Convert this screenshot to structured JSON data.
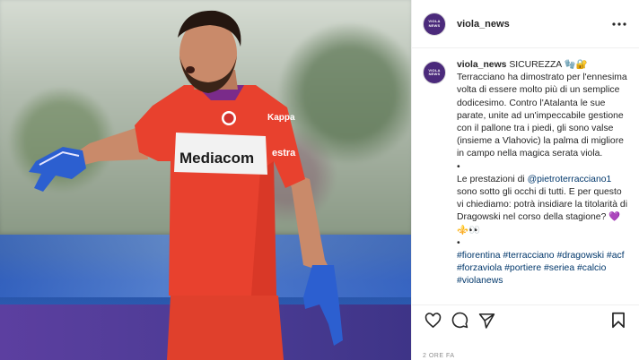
{
  "post": {
    "username": "viola_news",
    "avatar_text": [
      "VIOLA",
      "NEWS",
      "·"
    ],
    "caption": {
      "title": "SICUREZZA 🧤🔐",
      "p1": "Terracciano ha dimostrato per l'ennesima volta di essere molto più di un semplice dodicesimo. Contro l'Atalanta le sue parate, unite ad un'impeccabile gestione con il pallone tra i piedi, gli sono valse (insieme a Vlahovic) la palma di migliore in campo nella magica serata viola.",
      "bullet1": "•",
      "p2_pre": "Le prestazioni di ",
      "mention": "@pietroterracciano1",
      "p2_post": " sono sotto gli occhi di tutti. E per questo vi chiediamo: potrà insidiare la titolarità di Dragowski nel corso della stagione? ",
      "p2_emoji": "💜⚜️👀",
      "bullet2": "•",
      "hashtags": "#fiorentina #terracciano #dragowski #acf #forzaviola #portiere #seriea #calcio #violanews"
    },
    "time": "2 ORE FA"
  },
  "photo": {
    "sponsor": "Mediacom",
    "sponsor2": "estra",
    "brand": "Kappa"
  }
}
